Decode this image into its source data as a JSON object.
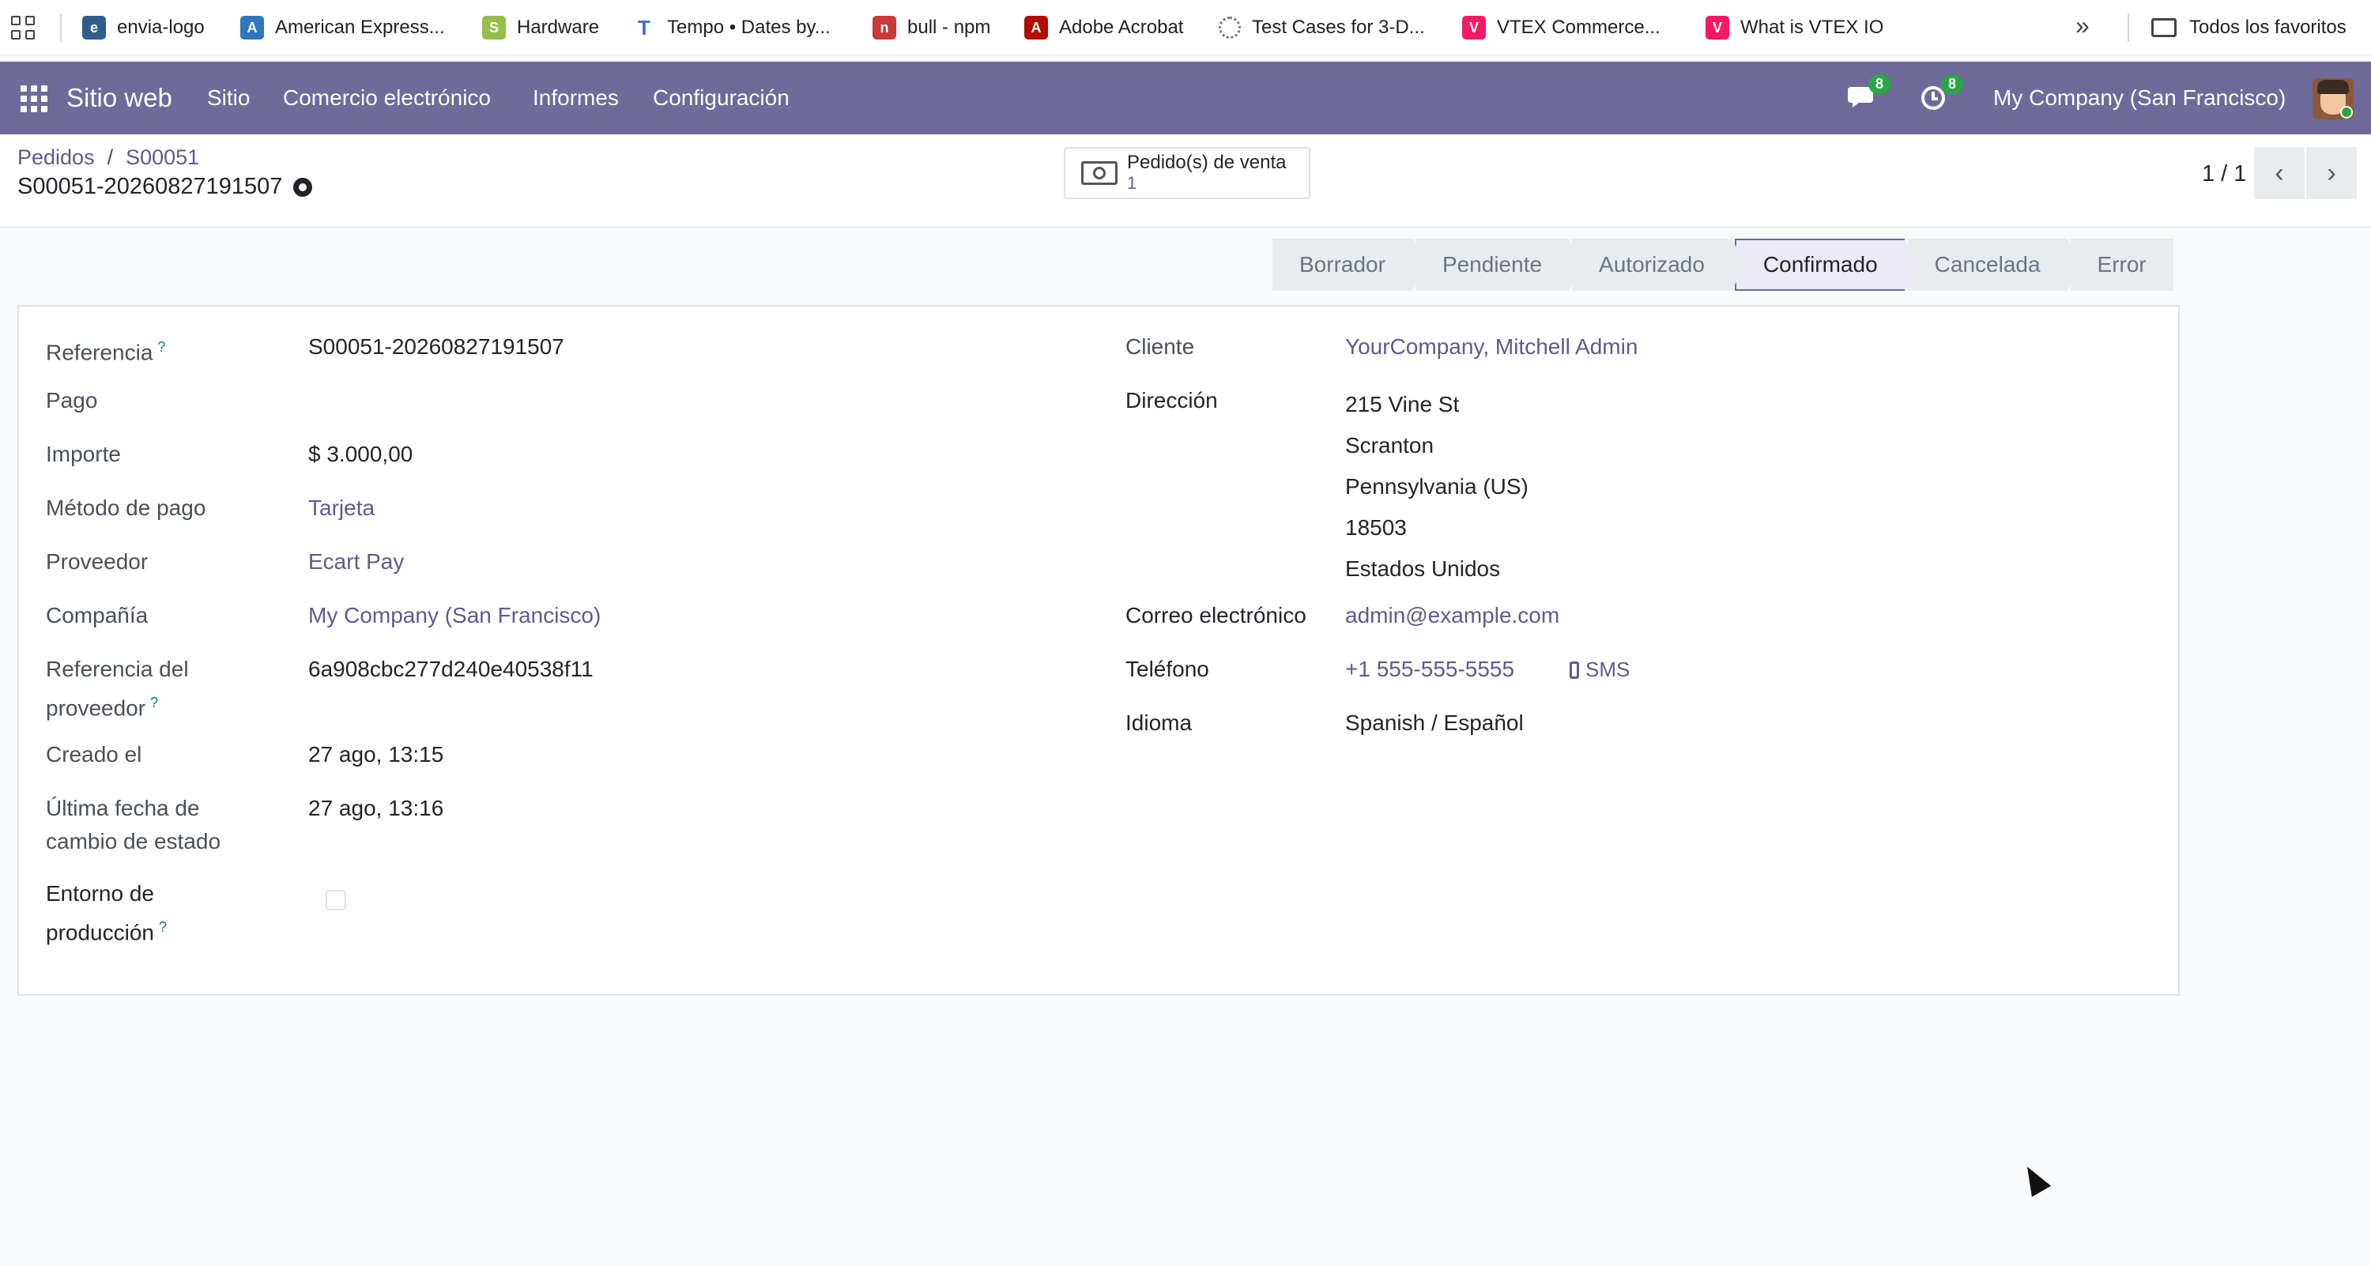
{
  "bookmarks": {
    "items": [
      {
        "label": "envia-logo",
        "icon": "envia-icon",
        "color": "#2f5d8a"
      },
      {
        "label": "American Express...",
        "icon": "amex-icon",
        "color": "#2e77bc"
      },
      {
        "label": "Hardware",
        "icon": "shopify-icon",
        "color": "#95bf47"
      },
      {
        "label": "Tempo • Dates by...",
        "icon": "tempo-icon",
        "color": "#3b6fd6"
      },
      {
        "label": "bull - npm",
        "icon": "npm-icon",
        "color": "#cb3837"
      },
      {
        "label": "Adobe Acrobat",
        "icon": "acrobat-icon",
        "color": "#b30b00"
      },
      {
        "label": "Test Cases for 3-D...",
        "icon": "loading-icon",
        "color": "#777777"
      },
      {
        "label": "VTEX Commerce...",
        "icon": "vtex-icon",
        "color": "#f71963"
      },
      {
        "label": "What is VTEX IO",
        "icon": "vtex-icon",
        "color": "#f71963"
      }
    ],
    "more": "»",
    "all_favorites": "Todos los favoritos"
  },
  "navbar": {
    "app_name": "Sitio web",
    "menu": [
      "Sitio",
      "Comercio electrónico",
      "Informes",
      "Configuración"
    ],
    "messages_count": "8",
    "activities_count": "8",
    "company": "My Company (San Francisco)",
    "accent": "#6e6a9a"
  },
  "control": {
    "breadcrumb": [
      "Pedidos",
      "S00051"
    ],
    "breadcrumb_sep": "/",
    "record_name": "S00051-20260827191507",
    "smart_button": {
      "label": "Pedido(s) de venta",
      "count": "1"
    },
    "pager": "1 / 1",
    "prev": "‹",
    "next": "›"
  },
  "status": {
    "stages": [
      "Borrador",
      "Pendiente",
      "Autorizado",
      "Confirmado",
      "Cancelada",
      "Error"
    ],
    "active": "Confirmado"
  },
  "form": {
    "left": {
      "reference_label": "Referencia",
      "reference_value": "S00051-20260827191507",
      "payment_label": "Pago",
      "amount_label": "Importe",
      "amount_value": "$ 3.000,00",
      "method_label": "Método de pago",
      "method_value": "Tarjeta",
      "provider_label": "Proveedor",
      "provider_value": "Ecart Pay",
      "company_label": "Compañía",
      "company_value": "My Company (San Francisco)",
      "provider_ref_label_1": "Referencia del",
      "provider_ref_label_2": "proveedor",
      "provider_ref_value": "6a908cbc277d240e40538f11",
      "created_label": "Creado el",
      "created_value": "27 ago, 13:15",
      "last_change_label_1": "Última fecha de",
      "last_change_label_2": "cambio de estado",
      "last_change_value": "27 ago, 13:16",
      "production_label_1": "Entorno de",
      "production_label_2": "producción",
      "production_checked": false
    },
    "right": {
      "customer_label": "Cliente",
      "customer_value": "YourCompany, Mitchell Admin",
      "address_label": "Dirección",
      "address_lines": [
        "215 Vine St",
        "Scranton",
        "Pennsylvania (US)",
        "18503",
        "Estados Unidos"
      ],
      "email_label": "Correo electrónico",
      "email_value": "admin@example.com",
      "phone_label": "Teléfono",
      "phone_value": "+1 555-555-5555",
      "sms_label": "SMS",
      "lang_label": "Idioma",
      "lang_value": "Spanish / Español"
    },
    "help_mark": "?"
  }
}
